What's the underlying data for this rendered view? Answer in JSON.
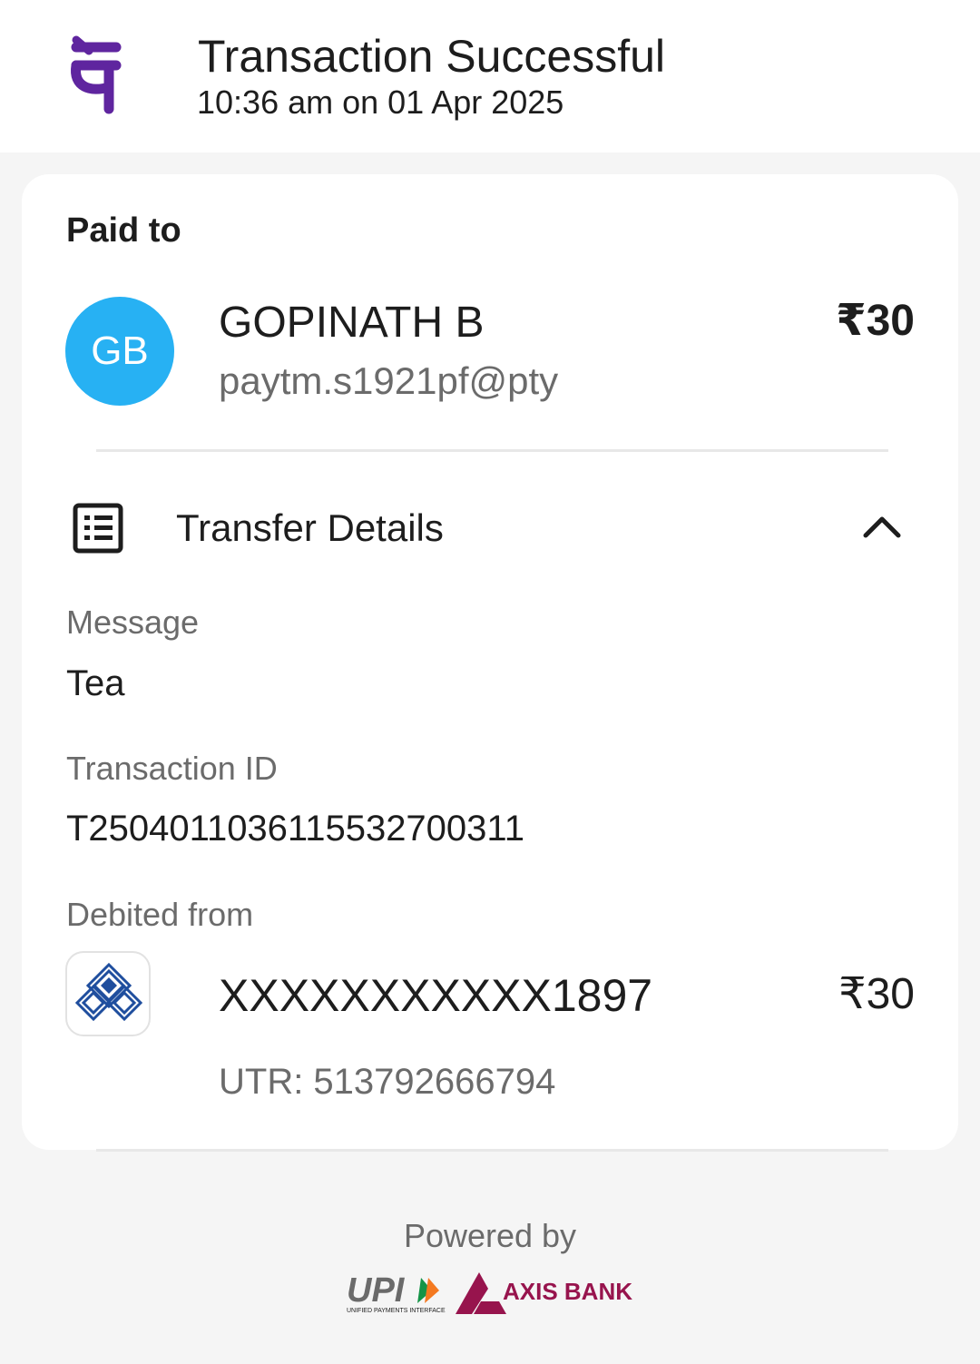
{
  "header": {
    "brand_icon": "phonepe-logo",
    "title": "Transaction Successful",
    "datetime": "10:36 am on 01 Apr 2025"
  },
  "paid_to": {
    "label": "Paid to",
    "avatar_initials": "GB",
    "avatar_color": "#27b1f3",
    "name": "GOPINATH B",
    "upi_id": "paytm.s1921pf@pty",
    "amount": "₹30"
  },
  "transfer_details": {
    "title": "Transfer Details",
    "icon": "receipt-list-icon",
    "toggle_icon": "chevron-up-icon",
    "expanded": true,
    "message_label": "Message",
    "message_value": "Tea",
    "transaction_id_label": "Transaction ID",
    "transaction_id_value": "T2504011036115532700311",
    "debited_from_label": "Debited from",
    "bank_icon": "bank-of-india-logo",
    "account_number": "XXXXXXXXXXX1897",
    "account_amount": "₹30",
    "utr": "UTR: 513792666794"
  },
  "footer": {
    "powered_by": "Powered by",
    "upi_logo_text": "UPI",
    "upi_tagline": "UNIFIED PAYMENTS INTERFACE",
    "bank_logo_text": "AXIS BANK"
  },
  "colors": {
    "brand_purple": "#5f259f",
    "bank_blue": "#1f4e9e",
    "axis_maroon": "#97144d",
    "upi_orange": "#f47920",
    "upi_green": "#149447"
  }
}
